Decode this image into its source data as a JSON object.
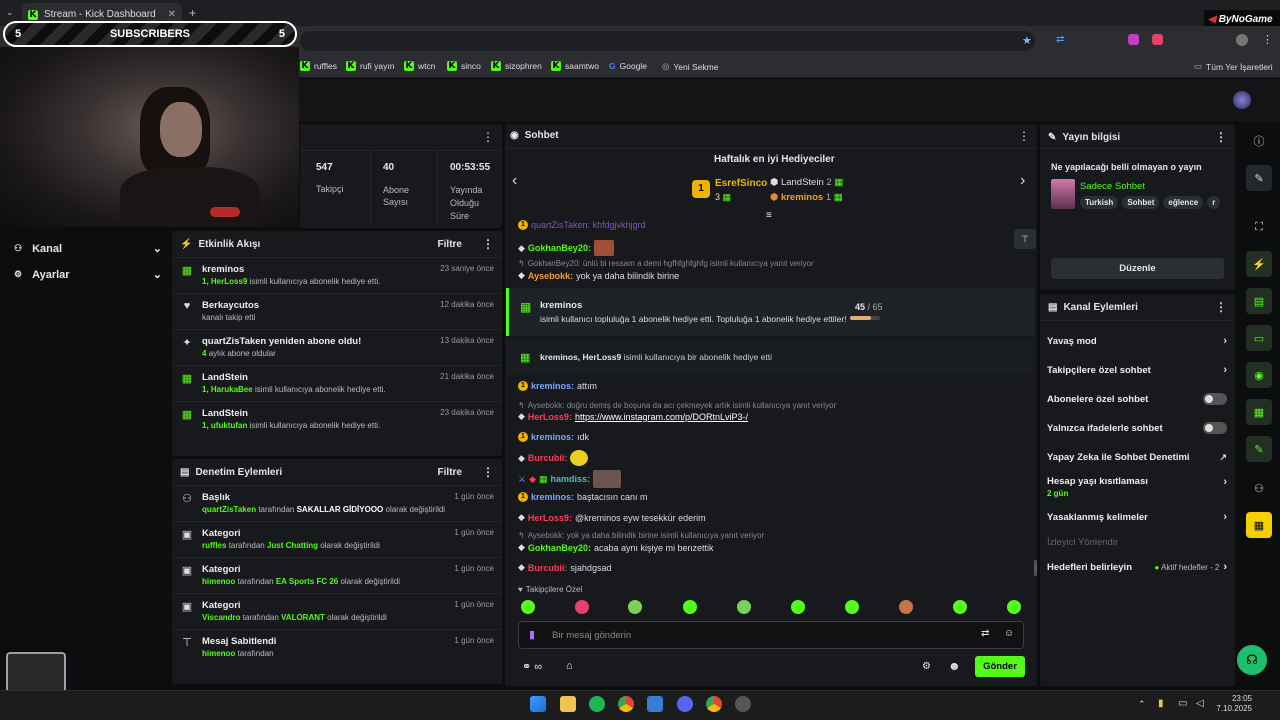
{
  "browser": {
    "tab_title": "Stream - Kick Dashboard",
    "bookmarks": [
      "ruffles",
      "rufi yayın",
      "wtcn",
      "sinco",
      "sizophren",
      "saamtwo",
      "Google",
      "Yeni Sekme"
    ],
    "bookmarks_all": "Tüm Yer İşaretleri"
  },
  "overlay": {
    "subs_left": "5",
    "subs_label": "SUBSCRIBERS",
    "subs_right": "5",
    "brand": "ByNoGame"
  },
  "stats": {
    "followers_value": "547",
    "followers_label": "Takipçi",
    "subs_value": "40",
    "subs_label_1": "Abone",
    "subs_label_2": "Sayısı",
    "time_value": "00:53:55",
    "time_label_1": "Yayında",
    "time_label_2": "Olduğu",
    "time_label_3": "Süre"
  },
  "sidebar": {
    "kanal": "Kanal",
    "ayarlar": "Ayarlar"
  },
  "activity": {
    "title": "Etkinlik Akışı",
    "filter": "Filtre",
    "items": [
      {
        "name": "kreminos",
        "sub_hl": "1, HerLoss9",
        "sub": "isimli kullanıcıya abonelik hediye etti.",
        "time": "23 saniye önce"
      },
      {
        "name": "Berkaycutos",
        "sub_hl": "",
        "sub": "kanalı takip etti",
        "time": "12 dakika önce"
      },
      {
        "name": "quartZisTaken yeniden abone oldu!",
        "sub_hl": "4",
        "sub": "aylık abone oldular",
        "time": "13 dakika önce"
      },
      {
        "name": "LandStein",
        "sub_hl": "1, HarukaBee",
        "sub": "isimli kullanıcıya abonelik hediye etti.",
        "time": "21 dakika önce"
      },
      {
        "name": "LandStein",
        "sub_hl": "1, ufuktufan",
        "sub": "isimli kullanıcıya abonelik hediye etti.",
        "time": "23 dakika önce"
      }
    ]
  },
  "moderation": {
    "title": "Denetim Eylemleri",
    "filter": "Filtre",
    "items": [
      {
        "name": "Başlık",
        "who": "quartZisTaken",
        "mid": "tarafından",
        "val": "SAKALLAR GİDİYOOO",
        "end": "olarak değiştirildi",
        "time": "1 gün önce"
      },
      {
        "name": "Kategori",
        "who": "ruffles",
        "mid": "tarafından",
        "val": "Just Chatting",
        "end": "olarak değiştirildi",
        "time": "1 gün önce"
      },
      {
        "name": "Kategori",
        "who": "himenoo",
        "mid": "tarafından",
        "val": "EA Sports FC 26",
        "end": "olarak değiştirildi",
        "time": "1 gün önce"
      },
      {
        "name": "Kategori",
        "who": "Viscandro",
        "mid": "tarafından",
        "val": "VALORANT",
        "end": "olarak değiştirildi",
        "time": "1 gün önce"
      },
      {
        "name": "Mesaj Sabitlendi",
        "who": "himenoo",
        "mid": "tarafından",
        "val": "",
        "end": "",
        "time": "1 gün önce"
      }
    ]
  },
  "chat": {
    "title": "Sohbet",
    "gifters_title": "Haftalık en iyi Hediyeciler",
    "gifter1_name": "EsrefSinco",
    "gifter1_count": "3",
    "gifter2_name": "LandStein",
    "gifter2_count": "2",
    "gifter3_name": "kreminos",
    "gifter3_count": "1",
    "top_cut": "quartZisTaken: khfdgjvkhjgrd",
    "m1_user": "GokhanBey20:",
    "r1": "GokhanBey20: ünlü bi ressam a demi hgfhfghfghfg isimli kullanıcıya yanıt veriyor",
    "m2_user": "Aysebokk:",
    "m2_text": "yok ya daha bilindik birine",
    "gift_user": "kreminos",
    "gift_text": "isimli kullanıcı topluluğa 1 abonelik hediye etti. Topluluğa 1 abonelik hediye ettiler!",
    "gift_progress": "45",
    "gift_goal": "/ 65",
    "gift_fraction": 0.69,
    "gift2_users": "kreminos, HerLoss9",
    "gift2_text": "isimli kullanıcıya bir abonelik hediye etti",
    "m3_user": "kreminos:",
    "m3_text": "attım",
    "r2": "Aysebokk: doğru demiş de boşuna da acı çekmeyek artık isimli kullanıcıya yanıt veriyor",
    "m4_user": "HerLoss9:",
    "m4_link": "https://www.instagram.com/p/DORtnLviP3-/",
    "m5_user": "kreminos:",
    "m5_text": "ıdk",
    "m6_user": "Burcubii:",
    "m7_user": "hamdiss:",
    "m8_user": "kreminos:",
    "m8_text": "baştacısın canı m",
    "m9_user": "HerLoss9:",
    "m9_text": "@kreminos eyw tesekkür ederim",
    "r3": "Aysebokk: yok ya daha bilindik birine isimli kullanıcıya yanıt veriyor",
    "m10_user": "GokhanBey20:",
    "m10_text": "acaba aynı kişiye mi benzettik",
    "m11_user": "Burcubii:",
    "m11_text": "sjahdgsad",
    "followers_only": "Takipçilere Özel",
    "input_placeholder": "Bir mesaj gönderin",
    "send": "Gönder"
  },
  "stream_info": {
    "title": "Yayın bilgisi",
    "stream_title": "Ne yapılacağı belli olmayan o yayın",
    "category": "Sadece Sohbet",
    "tags": [
      "Turkish",
      "Sohbet",
      "eğlence",
      "r"
    ],
    "edit": "Düzenle"
  },
  "channel_actions": {
    "title": "Kanal Eylemleri",
    "slow": "Yavaş mod",
    "followers": "Takipçilere özel sohbet",
    "subs": "Abonelere özel sohbet",
    "emotes": "Yalnızca ifadelerle sohbet",
    "ai": "Yapay Zeka ile Sohbet Denetimi",
    "age": "Hesap yaşı kısıtlaması",
    "age_val": "2 gün",
    "banned": "Yasaklanmış kelimeler",
    "raid": "İzleyici Yönlendir",
    "goals": "Hedefleri belirleyin",
    "goals_status": "Aktif hedefler - 2"
  },
  "taskbar": {
    "time": "23:05",
    "date": "7.10.2025"
  },
  "colors": {
    "accent": "#53fc18",
    "panel": "#17191c",
    "bg": "#0b0d0e"
  }
}
